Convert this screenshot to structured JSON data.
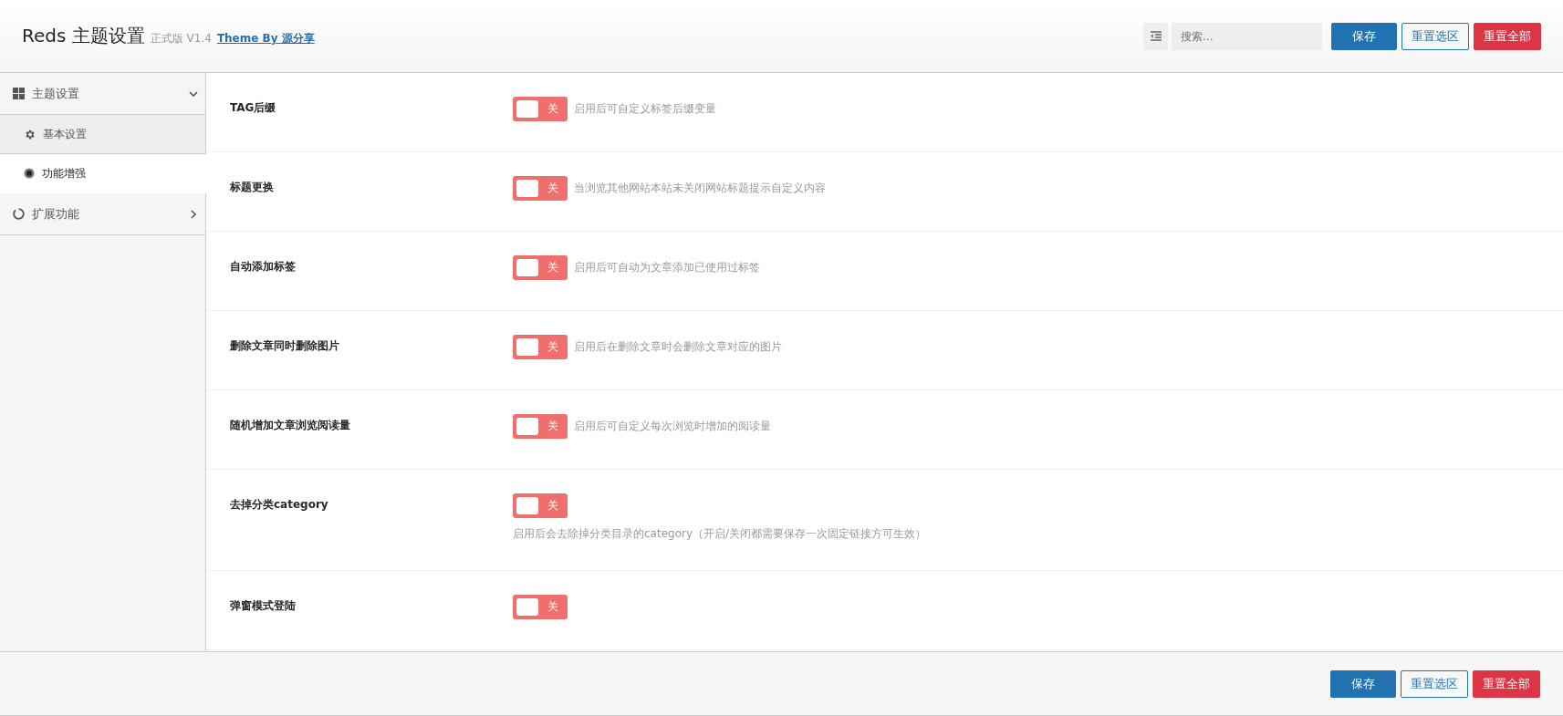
{
  "header": {
    "title": "Reds 主题设置",
    "version": "正式版 V1.4",
    "credit_link": "Theme By 源分享",
    "search": {
      "placeholder": "搜索..."
    },
    "buttons": [
      {
        "label": "保存",
        "kind": "primary"
      },
      {
        "label": "重置选区",
        "kind": "outline"
      },
      {
        "label": "重置全部",
        "kind": "danger"
      }
    ]
  },
  "sidebar": {
    "items": [
      {
        "label": "主题设置",
        "kind": "grid",
        "expanded": true,
        "children": [
          {
            "label": "基本设置",
            "kind": "gear",
            "selected": false
          },
          {
            "label": "功能增强",
            "kind": "dot",
            "selected": true
          }
        ]
      },
      {
        "label": "扩展功能",
        "kind": "ring",
        "expanded": false
      }
    ]
  },
  "settings": [
    {
      "label": "TAG后缀",
      "on": false,
      "switch_text": "关",
      "description": "启用后可自定义标签后缀变量",
      "kind": "inline"
    },
    {
      "label": "标题更换",
      "on": false,
      "switch_text": "关",
      "description": "当浏览其他网站本站未关闭网站标题提示自定义内容",
      "kind": "inline"
    },
    {
      "label": "自动添加标签",
      "on": false,
      "switch_text": "关",
      "description": "启用后可自动为文章添加已使用过标签",
      "kind": "inline"
    },
    {
      "label": "删除文章同时删除图片",
      "on": false,
      "switch_text": "关",
      "description": "启用后在删除文章时会删除文章对应的图片",
      "kind": "inline"
    },
    {
      "label": "随机增加文章浏览阅读量",
      "on": false,
      "switch_text": "关",
      "description": "启用后可自定义每次浏览时增加的阅读量",
      "kind": "inline"
    },
    {
      "label": "去掉分类category",
      "on": false,
      "switch_text": "关",
      "description": "启用后会去除掉分类目录的category（开启/关闭都需要保存一次固定链接方可生效）",
      "kind": "below"
    },
    {
      "label": "弹窗模式登陆",
      "on": false,
      "switch_text": "关",
      "kind": "inline"
    }
  ],
  "footer": {
    "buttons": [
      {
        "label": "保存",
        "kind": "primary"
      },
      {
        "label": "重置选区",
        "kind": "outline"
      },
      {
        "label": "重置全部",
        "kind": "danger"
      }
    ]
  }
}
